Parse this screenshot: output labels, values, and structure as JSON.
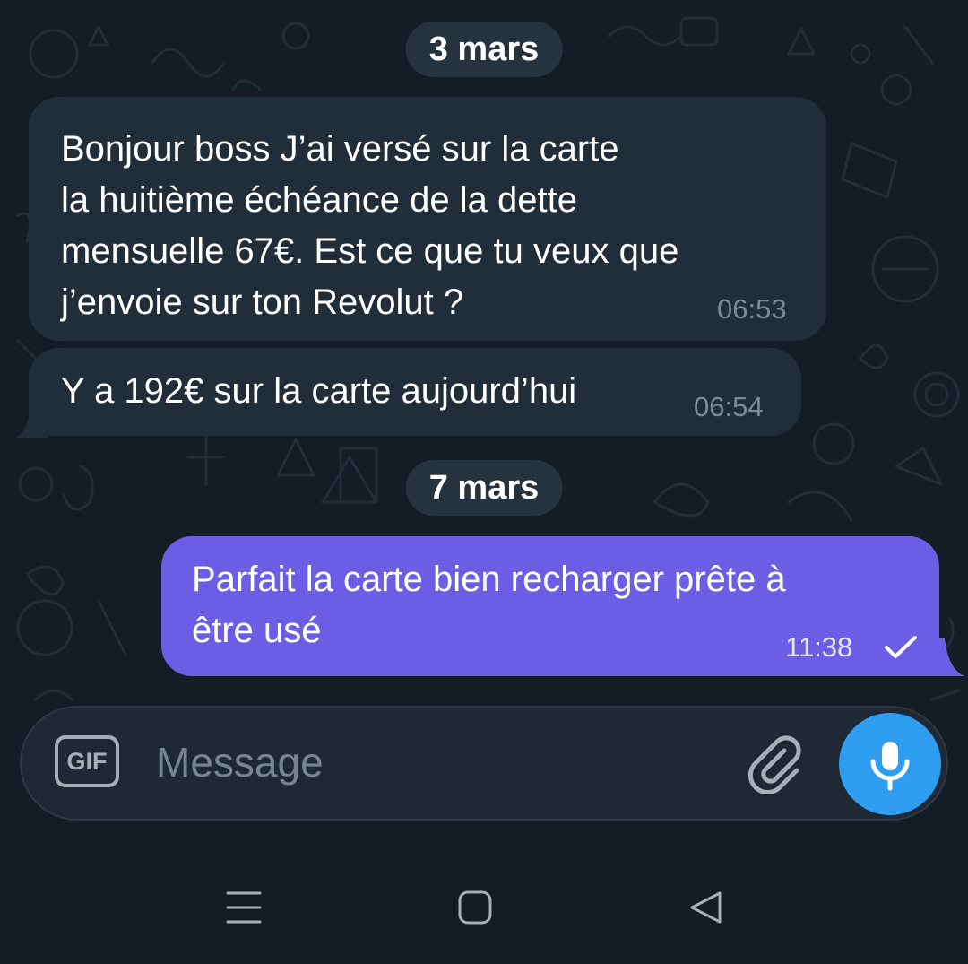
{
  "chat": {
    "date_1": "3 mars",
    "date_2": "7 mars",
    "messages": [
      {
        "direction": "incoming",
        "text": "Bonjour boss J’ai versé sur la carte\nla huitième échéance de la dette\nmensuelle 67€. Est ce que tu veux que\nj’envoie sur ton Revolut ?",
        "time": "06:53"
      },
      {
        "direction": "incoming",
        "text": "Y a 192€ sur la carte aujourd’hui",
        "time": "06:54"
      },
      {
        "direction": "outgoing",
        "text": "Parfait la carte bien recharger prête à\nêtre usé",
        "time": "11:38",
        "status_icon": "single-check-icon"
      }
    ]
  },
  "composer": {
    "gif_label": "GIF",
    "placeholder": "Message",
    "attach_icon": "paperclip-icon",
    "mic_icon": "microphone-icon"
  },
  "navbar": {
    "icons": [
      "menu-icon",
      "home-square-icon",
      "back-triangle-icon"
    ]
  },
  "colors": {
    "background": "#141d26",
    "incoming_bubble": "#212d39",
    "outgoing_bubble": "#6c5ee4",
    "accent": "#2f9ef0"
  }
}
